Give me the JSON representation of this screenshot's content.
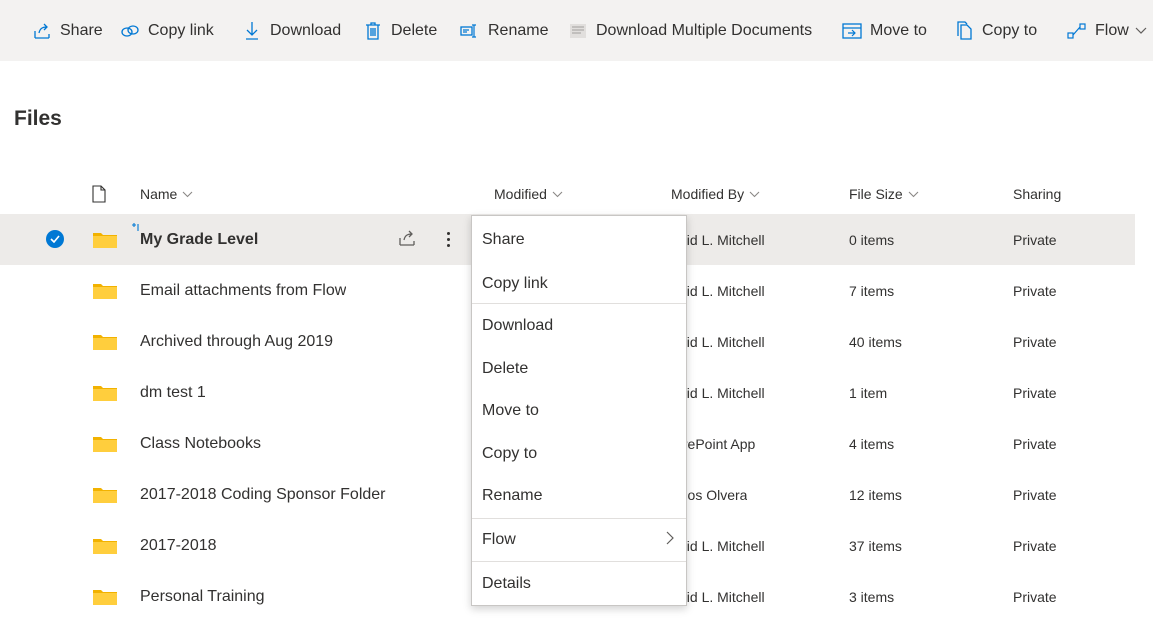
{
  "toolbar": {
    "share": "Share",
    "copy_link": "Copy link",
    "download": "Download",
    "delete": "Delete",
    "rename": "Rename",
    "download_multiple": "Download Multiple Documents",
    "move_to": "Move to",
    "copy_to": "Copy to",
    "flow": "Flow"
  },
  "page_title": "Files",
  "columns": {
    "name": "Name",
    "modified": "Modified",
    "modified_by": "Modified By",
    "file_size": "File Size",
    "sharing": "Sharing"
  },
  "rows": [
    {
      "name": "My Grade Level",
      "modified_by": "avid L. Mitchell",
      "size": "0 items",
      "sharing": "Private",
      "selected": true
    },
    {
      "name": "Email attachments from Flow",
      "modified_by": "avid L. Mitchell",
      "size": "7 items",
      "sharing": "Private"
    },
    {
      "name": "Archived through Aug 2019",
      "modified_by": "avid L. Mitchell",
      "size": "40 items",
      "sharing": "Private"
    },
    {
      "name": "dm test 1",
      "modified_by": "avid L. Mitchell",
      "size": "1 item",
      "sharing": "Private"
    },
    {
      "name": "Class Notebooks",
      "modified_by": "iarePoint App",
      "size": "4 items",
      "sharing": "Private"
    },
    {
      "name": "2017-2018 Coding Sponsor Folder",
      "modified_by": "arlos Olvera",
      "size": "12 items",
      "sharing": "Private"
    },
    {
      "name": "2017-2018",
      "modified_by": "avid L. Mitchell",
      "size": "37 items",
      "sharing": "Private"
    },
    {
      "name": "Personal Training",
      "modified_by": "avid L. Mitchell",
      "size": "3 items",
      "sharing": "Private"
    }
  ],
  "context_menu": {
    "share": "Share",
    "copy_link": "Copy link",
    "download": "Download",
    "delete": "Delete",
    "move_to": "Move to",
    "copy_to": "Copy to",
    "rename": "Rename",
    "flow": "Flow",
    "details": "Details"
  },
  "colors": {
    "accent": "#0078d4",
    "folder": "#ffce3d",
    "selected_row": "#edebe9",
    "toolbar_bg": "#f3f2f1"
  }
}
